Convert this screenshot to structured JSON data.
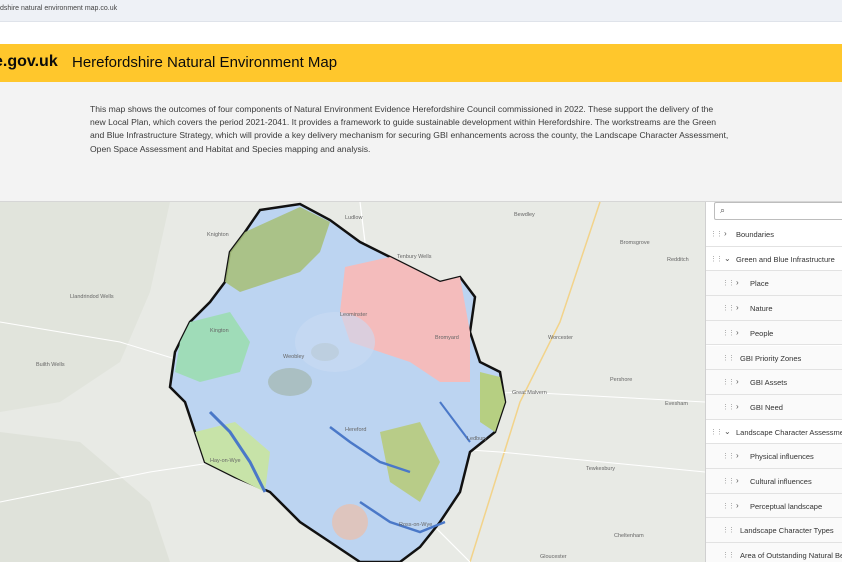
{
  "browser": {
    "url": "dshire natural environment map.co.uk"
  },
  "header": {
    "logo": "e.gov.uk",
    "title": "Herefordshire Natural Environment Map"
  },
  "intro": {
    "text": "This map shows the outcomes of four components of Natural Environment Evidence Herefordshire Council commissioned in 2022. These support the delivery of the new Local Plan, which covers the period 2021-2041. It provides a framework to guide sustainable development within Herefordshire. The workstreams are the Green and Blue Infrastructure Strategy, which will provide a key delivery mechanism for securing GBI enhancements across the county, the Landscape Character Assessment, Open Space Assessment and Habitat and Species mapping and analysis."
  },
  "map": {
    "places": [
      "Ludlow",
      "Bewdley",
      "Knighton",
      "Tenbury Wells",
      "Bromsgrove",
      "Redditch",
      "Llandrindod Wells",
      "Leominster",
      "Bromyard",
      "Worcester",
      "Weobley",
      "Great Malvern",
      "Pershore",
      "Evesham",
      "Hereford",
      "Ledbury",
      "Tewkesbury",
      "Ross-on-Wye",
      "Cheltenham",
      "Gloucester",
      "Builth Wells",
      "Hay-on-Wye",
      "Kington"
    ]
  },
  "layers": {
    "search_placeholder": "",
    "items": [
      {
        "label": "Boundaries",
        "expanded": false
      },
      {
        "label": "Green and Blue Infrastructure",
        "expanded": true
      },
      {
        "label": "Place",
        "expanded": false
      },
      {
        "label": "Nature",
        "expanded": false
      },
      {
        "label": "People",
        "expanded": false
      },
      {
        "label": "GBI Priority Zones",
        "expanded": false
      },
      {
        "label": "GBI Assets",
        "expanded": false
      },
      {
        "label": "GBI Need",
        "expanded": false
      },
      {
        "label": "Landscape Character Assessment",
        "expanded": true
      },
      {
        "label": "Physical influences",
        "expanded": false
      },
      {
        "label": "Cultural influences",
        "expanded": false
      },
      {
        "label": "Perceptual landscape",
        "expanded": false
      },
      {
        "label": "Landscape Character Types",
        "expanded": false
      },
      {
        "label": "Area of Outstanding Natural Beauty",
        "expanded": false
      }
    ]
  },
  "colors": {
    "header": "#ffc72c",
    "county_outline": "#111111",
    "gbi_blue": "#a9c8f0",
    "green": "#9bbd6f",
    "pink": "#f3b8b8"
  }
}
